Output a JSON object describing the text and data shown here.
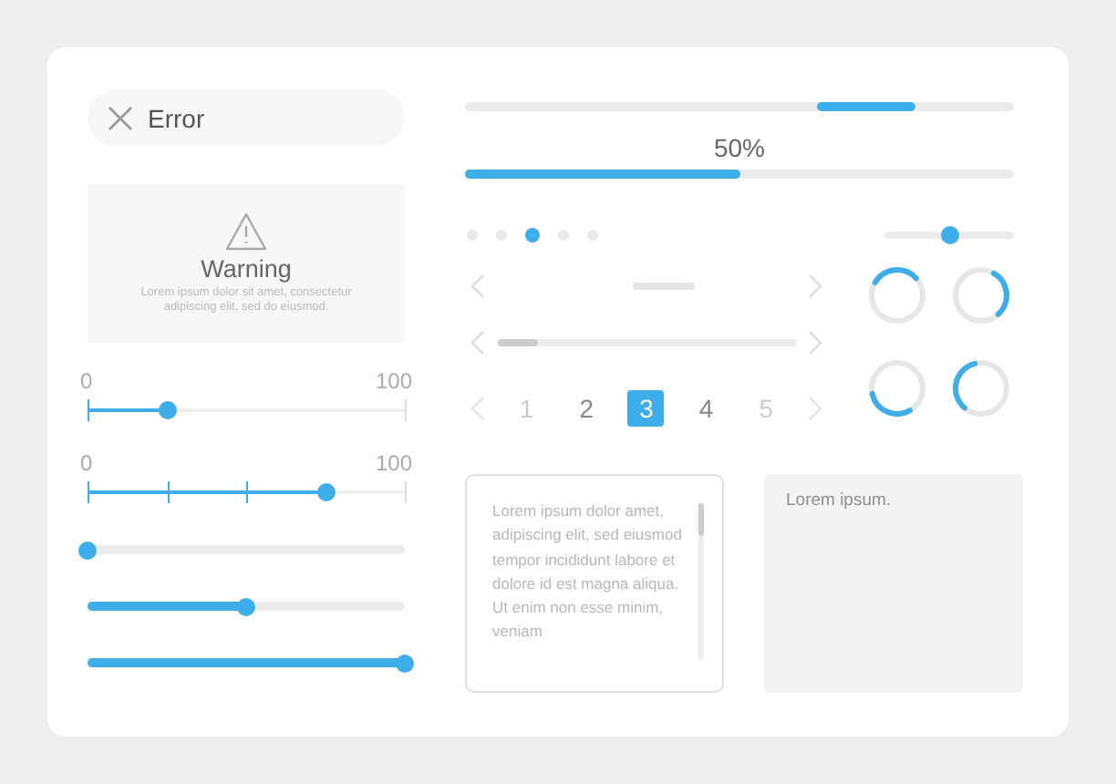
{
  "error_chip": {
    "label": "Error"
  },
  "warning_card": {
    "title": "Warning",
    "message": "Lorem ipsum dolor sit amet, consectetur adipiscing elit, sed do eiusmod."
  },
  "scale_sliders": [
    {
      "kind": "plain",
      "min_label": "0",
      "max_label": "100",
      "level": 0.25
    },
    {
      "kind": "stepped",
      "min_label": "0",
      "max_label": "100",
      "level": 0.75
    }
  ],
  "sliders": [
    {
      "level": 0
    },
    {
      "level": 0.5
    },
    {
      "level": 1
    }
  ],
  "progress": {
    "reading": "50%",
    "level": 0.5
  },
  "page_dots": [
    {
      "selected": false
    },
    {
      "selected": false
    },
    {
      "selected": true
    },
    {
      "selected": false
    },
    {
      "selected": false
    }
  ],
  "mini_slider": {
    "level": 0.5
  },
  "pagination": {
    "pages": [
      {
        "label": "1",
        "selected": false
      },
      {
        "label": "2",
        "selected": false
      },
      {
        "label": "3",
        "selected": true
      },
      {
        "label": "4",
        "selected": false
      },
      {
        "label": "5",
        "selected": false
      }
    ]
  },
  "text_area": {
    "text": "Lorem ipsum dolor amet, adipiscing elit, sed eiusmod tempor incididunt labore et dolore id est magna aliqua. Ut enim non esse minim, veniam"
  },
  "text_field": {
    "placeholder": "Lorem ipsum."
  }
}
